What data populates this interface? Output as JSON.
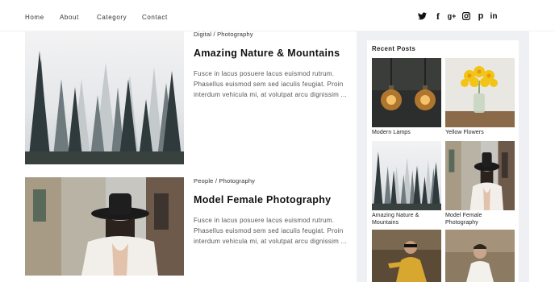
{
  "nav": {
    "items": [
      "Home",
      "About",
      "Category",
      "Contact"
    ]
  },
  "social": [
    {
      "icon": "twitter-icon",
      "glyph": ""
    },
    {
      "icon": "facebook-icon",
      "glyph": "f"
    },
    {
      "icon": "google-plus-icon",
      "glyph": "g+"
    },
    {
      "icon": "instagram-icon",
      "glyph": ""
    },
    {
      "icon": "pinterest-icon",
      "glyph": "p"
    },
    {
      "icon": "linkedin-icon",
      "glyph": "in"
    }
  ],
  "posts": [
    {
      "category": "Digital / Photography",
      "title": "Amazing Nature & Mountains",
      "excerpt": "Fusce in lacus posuere lacus euismod rutrum. Phasellus euismod sem sed iaculis feugiat. Proin interdum vehicula mi, at volutpat arcu dignissim ...",
      "image": "misty-forest"
    },
    {
      "category": "People / Photography",
      "title": "Model Female Photography",
      "excerpt": "Fusce in lacus posuere lacus euismod rutrum. Phasellus euismod sem sed iaculis feugiat. Proin interdum vehicula mi, at volutpat arcu dignissim ...",
      "image": "woman-in-hat"
    }
  ],
  "sidebar": {
    "title": "Recent Posts",
    "items": [
      {
        "label": "Modern Lamps",
        "image": "lamps"
      },
      {
        "label": "Yellow Flowers",
        "image": "flowers"
      },
      {
        "label": "Amazing Nature & Mountains",
        "image": "misty-forest"
      },
      {
        "label": "Model Female Photography",
        "image": "woman-in-hat"
      },
      {
        "label": "",
        "image": "woman-yellow"
      },
      {
        "label": "",
        "image": "man-outdoor"
      }
    ]
  },
  "colors": {
    "sidebar_bg": "#eef0f4",
    "text": "#222222"
  }
}
